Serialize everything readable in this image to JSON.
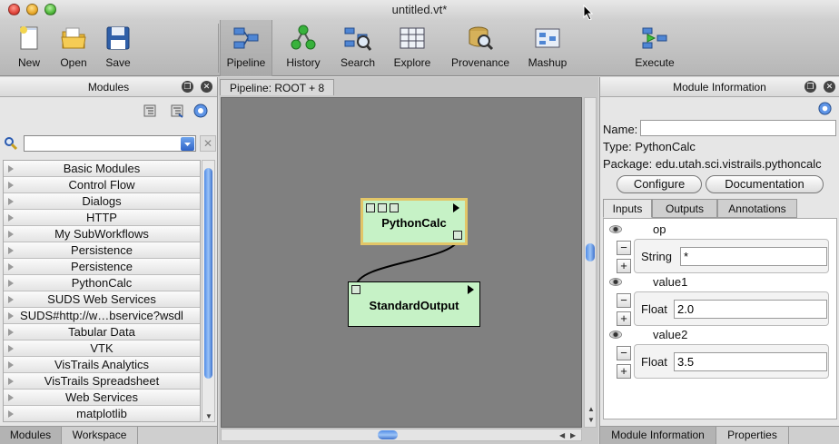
{
  "window": {
    "title": "untitled.vt*"
  },
  "toolbar": {
    "new": "New",
    "open": "Open",
    "save": "Save",
    "pipeline": "Pipeline",
    "history": "History",
    "search": "Search",
    "explore": "Explore",
    "provenance": "Provenance",
    "mashup": "Mashup",
    "execute": "Execute",
    "active": "Pipeline"
  },
  "modules_panel": {
    "title": "Modules",
    "search_value": "",
    "items": [
      "Basic Modules",
      "Control Flow",
      "Dialogs",
      "HTTP",
      "My SubWorkflows",
      "Persistence",
      "Persistence",
      "PythonCalc",
      "SUDS Web Services",
      "SUDS#http://w…bservice?wsdl",
      "Tabular Data",
      "VTK",
      "VisTrails Analytics",
      "VisTrails Spreadsheet",
      "Web Services",
      "matplotlib"
    ],
    "tabs": [
      "Modules",
      "Workspace"
    ]
  },
  "pipeline": {
    "tab_label": "Pipeline: ROOT + 8",
    "nodes": {
      "pythoncalc": "PythonCalc",
      "standardoutput": "StandardOutput"
    }
  },
  "module_info": {
    "title": "Module Information",
    "name_label": "Name:",
    "name_value": "",
    "type_label": "Type:",
    "type_value": "PythonCalc",
    "package_label": "Package:",
    "package_value": "edu.utah.sci.vistrails.pythoncalc",
    "configure": "Configure",
    "documentation": "Documentation",
    "tabs": [
      "Inputs",
      "Outputs",
      "Annotations"
    ],
    "ports": [
      {
        "name": "op",
        "type": "String",
        "value": "*"
      },
      {
        "name": "value1",
        "type": "Float",
        "value": "2.0"
      },
      {
        "name": "value2",
        "type": "Float",
        "value": "3.5"
      }
    ],
    "bottom_tabs": [
      "Module Information",
      "Properties"
    ]
  },
  "colors": {
    "accent": "#3e72cc",
    "node_fill": "#c6f2c6",
    "selected_border": "#e2c668",
    "canvas": "#808080"
  }
}
